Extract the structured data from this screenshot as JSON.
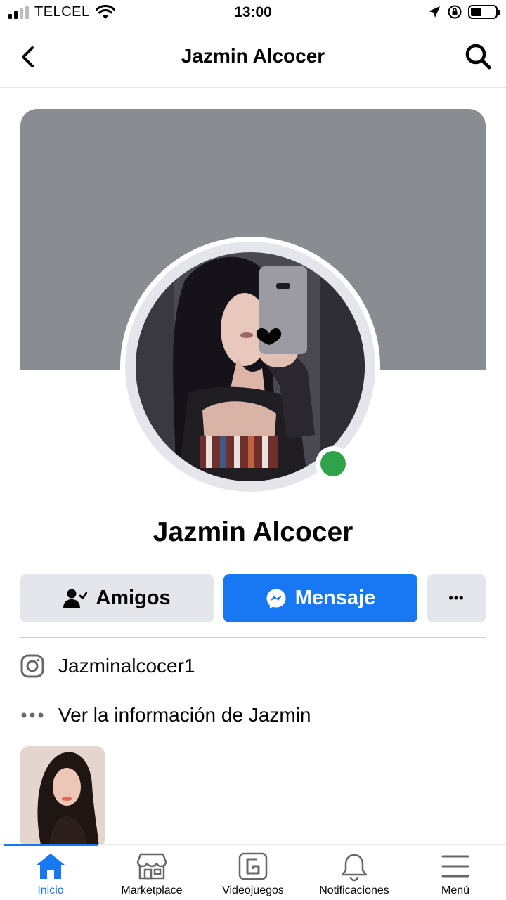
{
  "status_bar": {
    "carrier": "TELCEL",
    "time": "13:00",
    "battery_level": 0.45
  },
  "header": {
    "title": "Jazmin Alcocer"
  },
  "profile": {
    "name": "Jazmin Alcocer",
    "online": true
  },
  "actions": {
    "friends_label": "Amigos",
    "message_label": "Mensaje",
    "more_label": "•••"
  },
  "info": {
    "instagram": "Jazminalcocer1",
    "more_info": "Ver la información de Jazmin"
  },
  "bottom_nav": {
    "items": [
      {
        "label": "Inicio",
        "icon": "home-icon",
        "active": true
      },
      {
        "label": "Marketplace",
        "icon": "marketplace-icon"
      },
      {
        "label": "Videojuegos",
        "icon": "gaming-icon"
      },
      {
        "label": "Notificaciones",
        "icon": "bell-icon"
      },
      {
        "label": "Menú",
        "icon": "menu-icon"
      }
    ]
  },
  "colors": {
    "accent": "#1877f2",
    "online": "#31a24c",
    "cover": "#898c91",
    "button_gray": "#e4e6eb"
  }
}
